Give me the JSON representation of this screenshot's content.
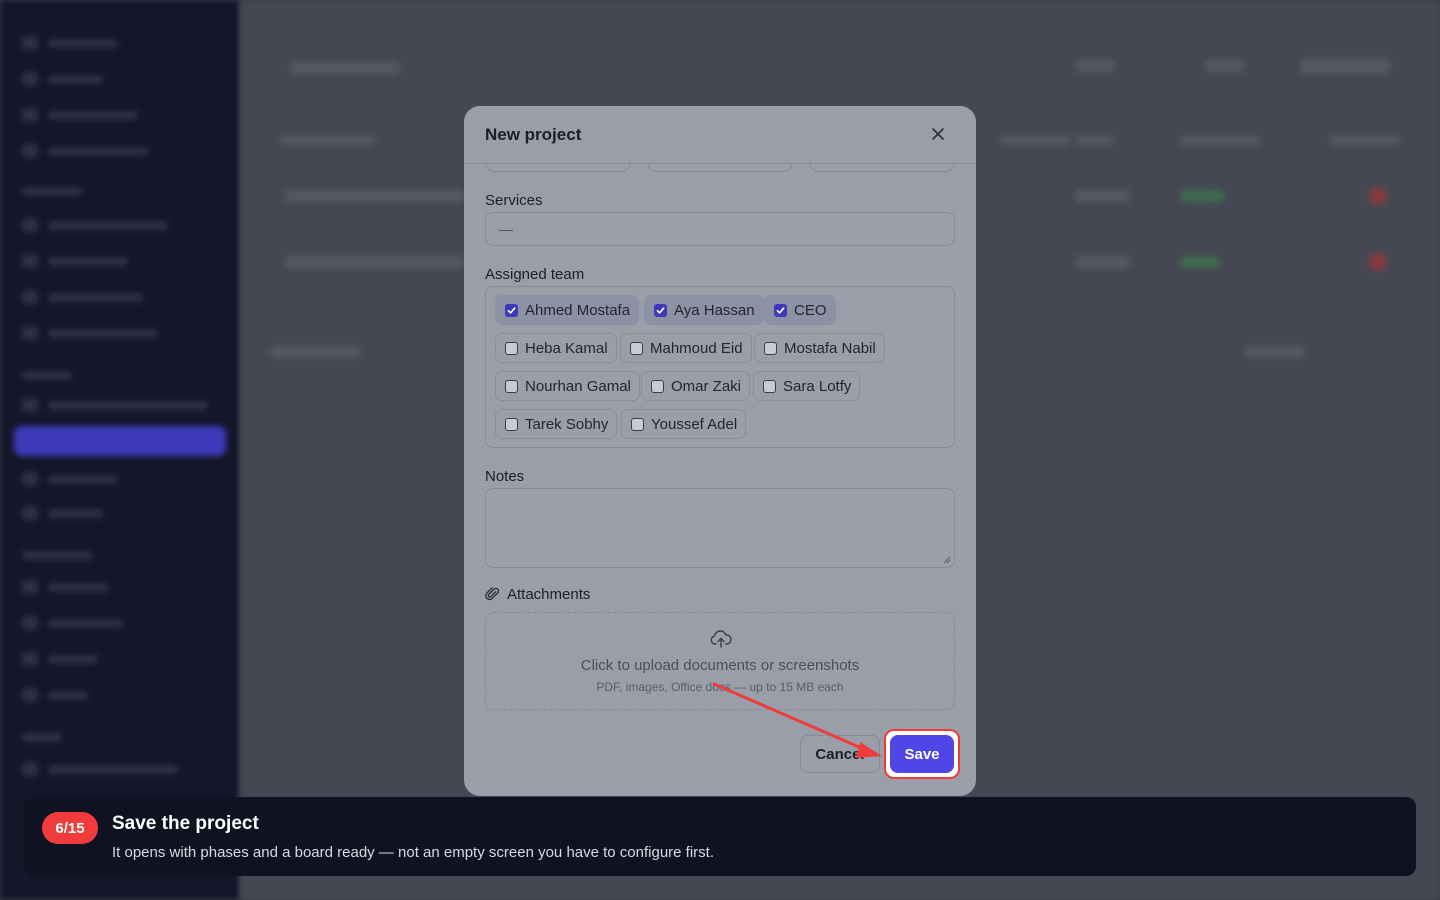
{
  "modal": {
    "title": "New project",
    "services": {
      "label": "Services",
      "value": "—"
    },
    "assigned_team": {
      "label": "Assigned team",
      "members": [
        {
          "name": "Ahmed Mostafa",
          "checked": true
        },
        {
          "name": "Aya Hassan",
          "checked": true
        },
        {
          "name": "CEO",
          "checked": true
        },
        {
          "name": "Heba Kamal",
          "checked": false
        },
        {
          "name": "Mahmoud Eid",
          "checked": false
        },
        {
          "name": "Mostafa Nabil",
          "checked": false
        },
        {
          "name": "Nourhan Gamal",
          "checked": false
        },
        {
          "name": "Omar Zaki",
          "checked": false
        },
        {
          "name": "Sara Lotfy",
          "checked": false
        },
        {
          "name": "Tarek Sobhy",
          "checked": false
        },
        {
          "name": "Youssef Adel",
          "checked": false
        }
      ]
    },
    "notes": {
      "label": "Notes",
      "value": ""
    },
    "attachments": {
      "label": "Attachments",
      "upload_text": "Click to upload documents or screenshots",
      "upload_hint": "PDF, images, Office docs — up to 15 MB each"
    },
    "cancel_label": "Cancel",
    "save_label": "Save"
  },
  "tour": {
    "step": "6/15",
    "title": "Save the project",
    "text": "It opens with phases and a board ready — not an empty screen you have to configure first."
  },
  "colors": {
    "accent": "#4f46e5",
    "highlight": "#ef3b3b",
    "tour_bg": "#0f1220"
  }
}
